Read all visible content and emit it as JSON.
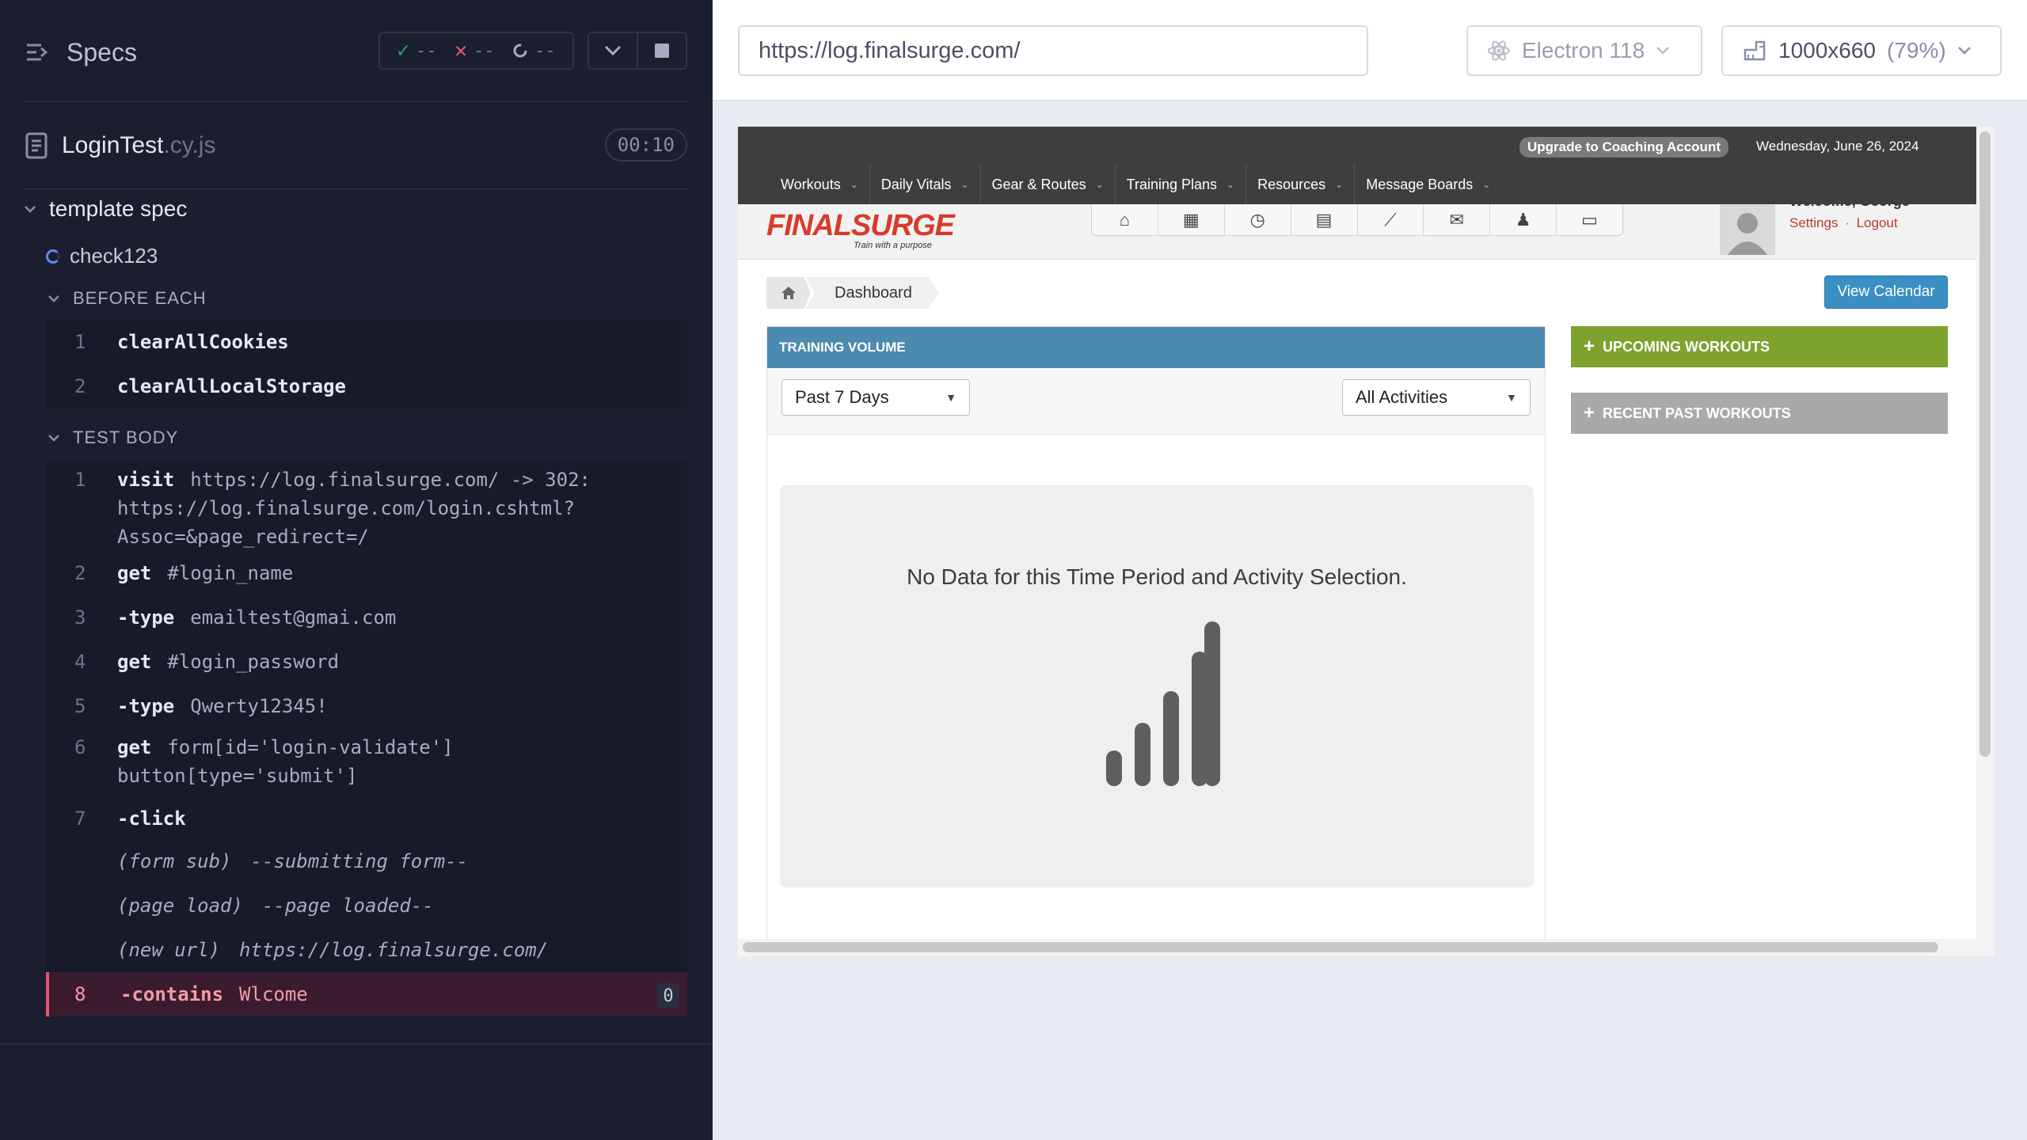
{
  "runner": {
    "specs_label": "Specs",
    "stats": {
      "passed": "--",
      "failed": "--",
      "pending": "--"
    },
    "spec_file": {
      "name": "LoginTest",
      "ext": ".cy.js",
      "duration": "00:10"
    },
    "suite": "template spec",
    "test": "check123",
    "before_each": {
      "label": "BEFORE EACH",
      "commands": [
        {
          "num": "1",
          "name": "clearAllCookies"
        },
        {
          "num": "2",
          "name": "clearAllLocalStorage"
        }
      ]
    },
    "test_body": {
      "label": "TEST BODY",
      "commands": [
        {
          "num": "1",
          "name": "visit",
          "arg": "https://log.finalsurge.com/ -> 302:",
          "arg2": "https://log.finalsurge.com/login.cshtml?",
          "arg3": "Assoc=&page_redirect=/"
        },
        {
          "num": "2",
          "name": "get",
          "arg": "#login_name"
        },
        {
          "num": "3",
          "name": "-type",
          "arg": "emailtest@gmai.com"
        },
        {
          "num": "4",
          "name": "get",
          "arg": "#login_password"
        },
        {
          "num": "5",
          "name": "-type",
          "arg": "Qwerty12345!"
        },
        {
          "num": "6",
          "name": "get",
          "arg": "form[id='login-validate']",
          "arg2": "button[type='submit']"
        },
        {
          "num": "7",
          "name": "-click"
        },
        {
          "event": "(form sub)",
          "arg": "--submitting form--"
        },
        {
          "event": "(page load)",
          "arg": "--page loaded--"
        },
        {
          "event": "(new url)",
          "arg": "https://log.finalsurge.com/"
        },
        {
          "num": "8",
          "name": "-contains",
          "arg": "Wlcome",
          "badge": "0"
        }
      ]
    }
  },
  "browser": {
    "url": "https://log.finalsurge.com/",
    "browser_name": "Electron 118",
    "viewport": "1000x660",
    "scale": "(79%)"
  },
  "aut": {
    "upgrade_label": "Upgrade to Coaching Account",
    "date": "Wednesday, June 26, 2024",
    "nav": [
      "Workouts",
      "Daily Vitals",
      "Gear & Routes",
      "Training Plans",
      "Resources",
      "Message Boards"
    ],
    "logo_text": "FINALSURGE",
    "logo_tagline": "Train with a purpose",
    "user_greeting": "Welcome, George",
    "settings_label": "Settings",
    "separator": "·",
    "logout_label": "Logout",
    "breadcrumb": "Dashboard",
    "view_calendar": "View Calendar",
    "training_volume": "TRAINING VOLUME",
    "period_select": "Past 7 Days",
    "activity_select": "All Activities",
    "no_data": "No Data for this Time Period and Activity Selection.",
    "upcoming": "UPCOMING WORKOUTS",
    "recent": "RECENT PAST WORKOUTS",
    "colors": {
      "topbar": "#3e3e3e",
      "header_blue": "#4d8ab0",
      "green": "#7da22e",
      "grey": "#a9a9a9",
      "brand_red": "#d93b2b"
    }
  }
}
